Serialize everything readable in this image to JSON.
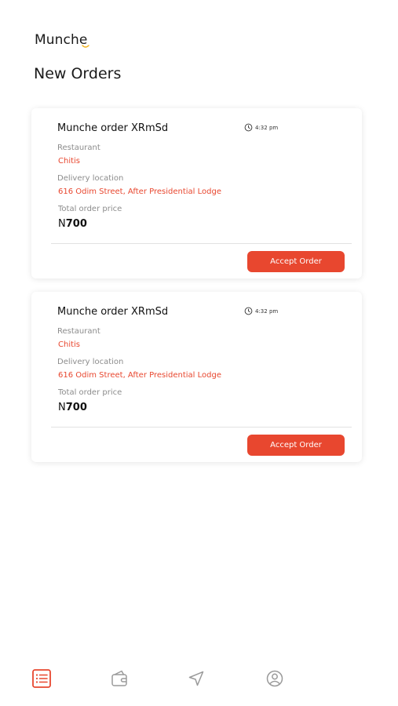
{
  "app": {
    "logo": "Munche",
    "page_title": "New Orders"
  },
  "colors": {
    "accent": "#e8472f",
    "logo_smile": "#f2b21c",
    "inactive_icon": "#9a9a9a"
  },
  "orders": [
    {
      "name": "Munche order XRmSd",
      "time": "4:32 pm",
      "restaurant_label": "Restaurant",
      "restaurant": "Chitis",
      "delivery_label": "Delivery location",
      "delivery": "616 Odim Street, After Presidential Lodge",
      "price_label": "Total order price",
      "currency": "N",
      "price": "700",
      "action": "Accept Order"
    },
    {
      "name": "Munche order XRmSd",
      "time": "4:32 pm",
      "restaurant_label": "Restaurant",
      "restaurant": "Chitis",
      "delivery_label": "Delivery location",
      "delivery": "616 Odim Street, After Presidential Lodge",
      "price_label": "Total order price",
      "currency": "N",
      "price": "700",
      "action": "Accept Order"
    }
  ],
  "bottom_nav": [
    {
      "icon": "orders-list-icon",
      "active": true
    },
    {
      "icon": "wallet-icon",
      "active": false
    },
    {
      "icon": "navigation-icon",
      "active": false
    },
    {
      "icon": "profile-icon",
      "active": false
    }
  ]
}
